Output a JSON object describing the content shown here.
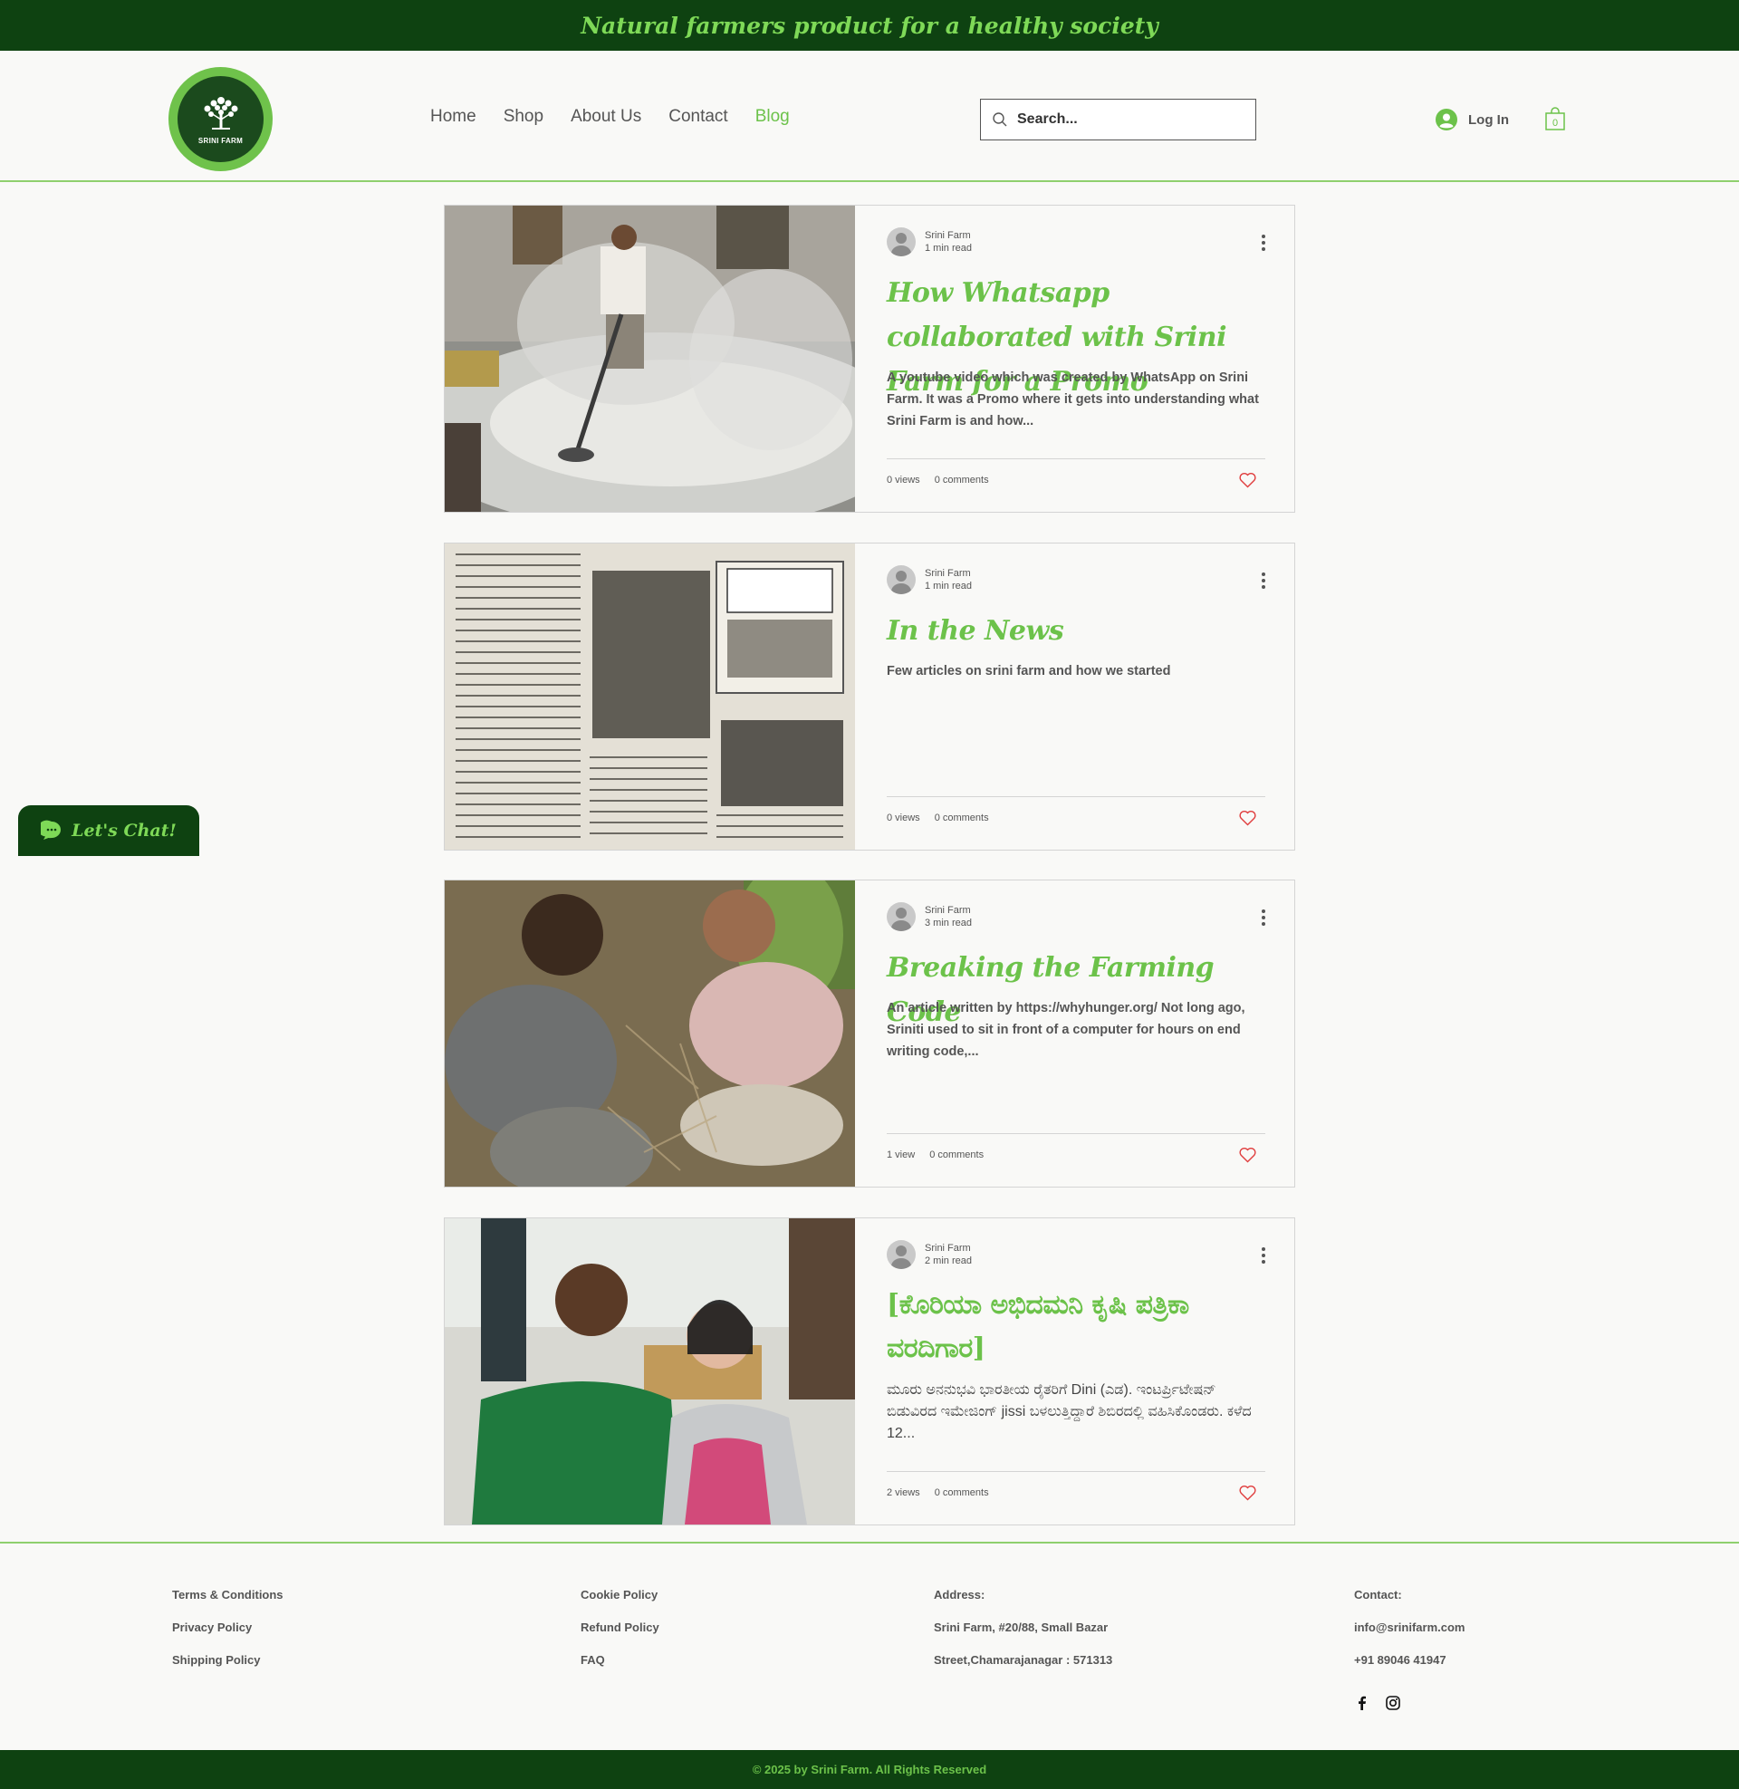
{
  "topbar": {
    "tagline": "Natural farmers product for a healthy society"
  },
  "header": {
    "logo_text": "SRINI FARM",
    "nav": [
      "Home",
      "Shop",
      "About Us",
      "Contact",
      "Blog"
    ],
    "search_placeholder": "Search...",
    "login_label": "Log In",
    "cart_count": "0"
  },
  "posts": [
    {
      "author": "Srini Farm",
      "read_time": "1 min read",
      "title": "How Whatsapp collaborated with Srini Farm for a Promo",
      "excerpt": "A youtube video which was created by WhatsApp on Srini Farm. It was a Promo where it gets into understanding what Srini Farm is and how...",
      "views": "0 views",
      "comments": "0 comments"
    },
    {
      "author": "Srini Farm",
      "read_time": "1 min read",
      "title": "In the News",
      "excerpt": "Few articles on srini farm and how we started",
      "views": "0 views",
      "comments": "0 comments"
    },
    {
      "author": "Srini Farm",
      "read_time": "3 min read",
      "title": "Breaking the Farming Code",
      "excerpt": "An article written by https://whyhunger.org/ Not long ago, Sriniti used to sit in front of a computer for hours on end writing code,...",
      "views": "1 view",
      "comments": "0 comments"
    },
    {
      "author": "Srini Farm",
      "read_time": "2 min read",
      "title": "[ಕೊರಿಯಾ ಅಭಿದಮನಿ ಕೃಷಿ ಪತ್ರಿಕಾ ವರದಿಗಾರ]",
      "excerpt": "ಮೂರು ಅನನುಭವಿ ಭಾರತೀಯ ರೈತರಿಗೆ Dini (ಎಡ). ಇಂಟರ್ಪ್ರಿಟೇಷನ್ ಬಿಡುವಿರದ ಇಮೇಜಿಂಗ್ jissi ಬಳಲುತ್ತಿದ್ದಾರೆ ಶಿಬಿರದಲ್ಲಿ ವಹಿಸಿಕೊಂಡರು. ಕಳೆದ 12...",
      "views": "2 views",
      "comments": "0 comments"
    }
  ],
  "chat": {
    "label": "Let's Chat!"
  },
  "footer": {
    "col1": [
      "Terms & Conditions",
      "Privacy Policy",
      "Shipping Policy"
    ],
    "col2": [
      "Cookie Policy",
      "Refund Policy",
      "FAQ"
    ],
    "address": [
      "Address:",
      "Srini Farm, #20/88, Small Bazar",
      "Street,Chamarajanagar : 571313"
    ],
    "contact": [
      "Contact:",
      "info@srinifarm.com",
      "+91 89046 41947"
    ],
    "copyright": "© 2025 by Srini Farm. All Rights Reserved"
  },
  "colors": {
    "dark_green": "#0e4211",
    "accent_green": "#6cc24a",
    "heart_red": "#e03e3e"
  }
}
